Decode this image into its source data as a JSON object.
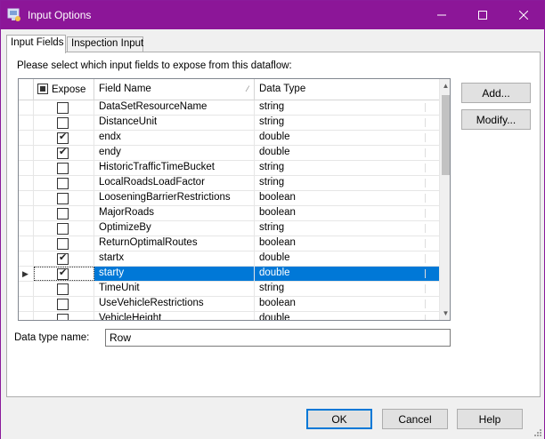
{
  "window": {
    "title": "Input Options",
    "minimize_glyph": "—",
    "maximize_glyph": "☐",
    "close_glyph": "✕"
  },
  "tabs": [
    {
      "label": "Input Fields",
      "active": true
    },
    {
      "label": "Inspection Input",
      "active": false
    }
  ],
  "instruction": "Please select which input fields to expose from this dataflow:",
  "grid": {
    "columns": {
      "expose": "Expose",
      "field_name": "Field Name",
      "data_type": "Data Type"
    },
    "rows": [
      {
        "field": "DataSetResourceName",
        "type": "string",
        "expose": false
      },
      {
        "field": "DistanceUnit",
        "type": "string",
        "expose": false
      },
      {
        "field": "endx",
        "type": "double",
        "expose": true
      },
      {
        "field": "endy",
        "type": "double",
        "expose": true
      },
      {
        "field": "HistoricTrafficTimeBucket",
        "type": "string",
        "expose": false
      },
      {
        "field": "LocalRoadsLoadFactor",
        "type": "string",
        "expose": false
      },
      {
        "field": "LooseningBarrierRestrictions",
        "type": "boolean",
        "expose": false
      },
      {
        "field": "MajorRoads",
        "type": "boolean",
        "expose": false
      },
      {
        "field": "OptimizeBy",
        "type": "string",
        "expose": false
      },
      {
        "field": "ReturnOptimalRoutes",
        "type": "boolean",
        "expose": false
      },
      {
        "field": "startx",
        "type": "double",
        "expose": true
      },
      {
        "field": "starty",
        "type": "double",
        "expose": true,
        "selected": true
      },
      {
        "field": "TimeUnit",
        "type": "string",
        "expose": false
      },
      {
        "field": "UseVehicleRestrictions",
        "type": "boolean",
        "expose": false
      },
      {
        "field": "VehicleHeight",
        "type": "double",
        "expose": false
      }
    ]
  },
  "buttons": {
    "add": "Add...",
    "modify": "Modify...",
    "ok": "OK",
    "cancel": "Cancel",
    "help": "Help"
  },
  "data_type_name": {
    "label": "Data type name:",
    "value": "Row"
  },
  "colors": {
    "titlebar": "#8c1698",
    "selection": "#0078d7"
  }
}
